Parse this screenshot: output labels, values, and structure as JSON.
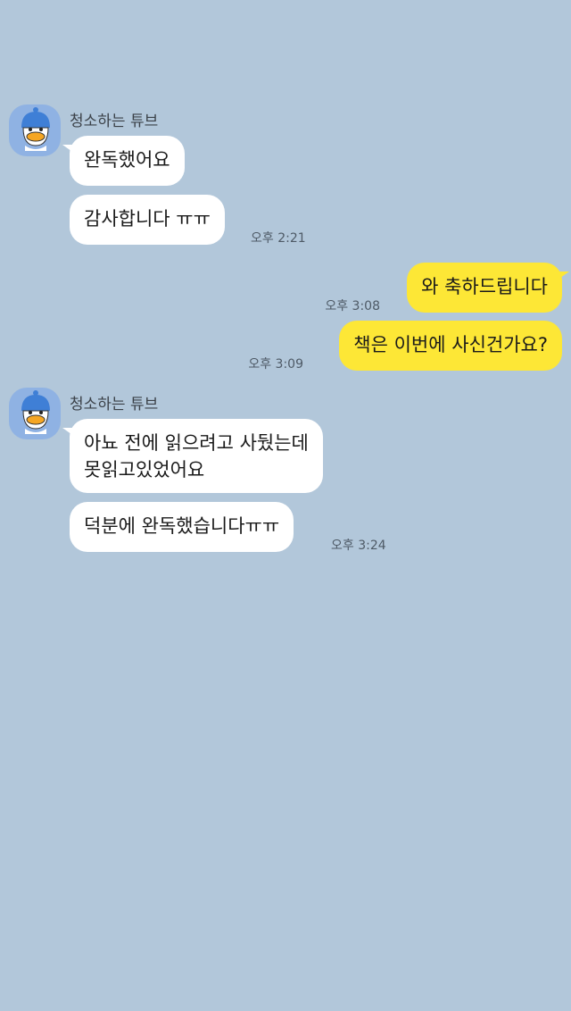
{
  "chat": {
    "sender_name": "청소하는 튜브",
    "groups": [
      {
        "messages": [
          "완독했어요",
          "감사합니다 ㅠㅠ"
        ],
        "time": "오후 2:21"
      },
      {
        "messages": [
          "와 축하드립니다",
          "책은 이번에 사신건가요?"
        ],
        "times": [
          "오후 3:08",
          "오후 3:09"
        ]
      },
      {
        "messages": [
          "아뇨 전에 읽으려고 사뒀는데\n못읽고있었어요",
          "덕분에 완독했습니다ㅠㅠ"
        ],
        "time": "오후 3:24"
      }
    ]
  },
  "colors": {
    "background": "#b2c7da",
    "incoming_bubble": "#ffffff",
    "outgoing_bubble": "#fde736",
    "avatar_bg": "#8fb2e3"
  }
}
